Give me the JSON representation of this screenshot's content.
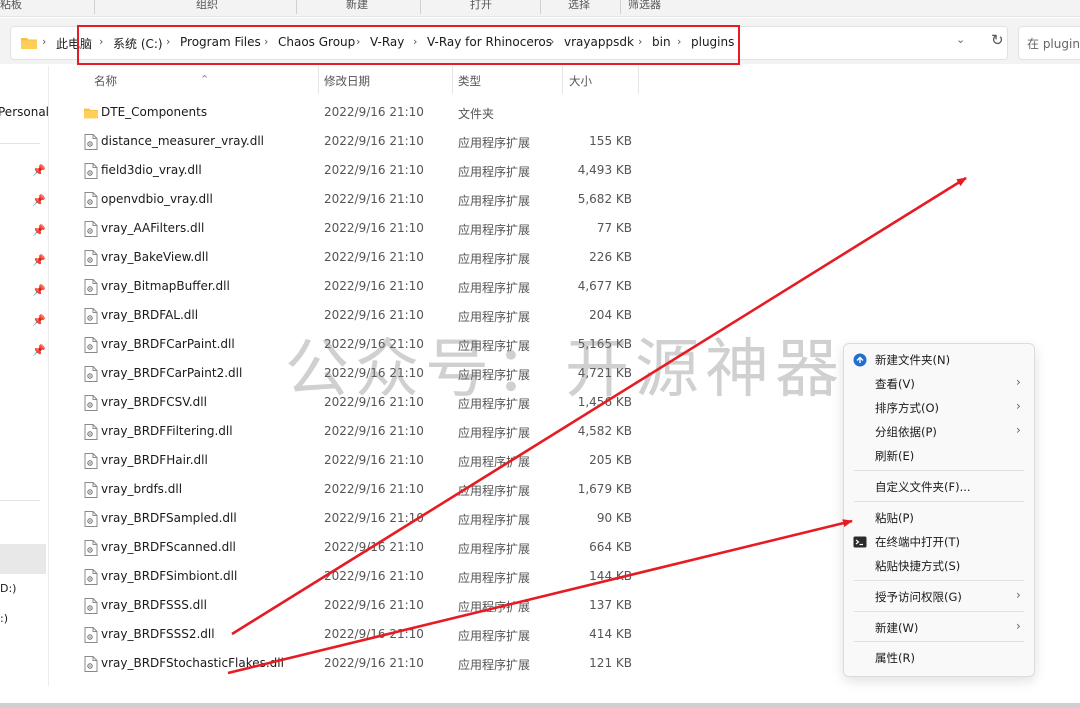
{
  "ribbon": {
    "labels": [
      "粘板",
      "组织",
      "新建",
      "打开",
      "选择",
      "筛选器"
    ]
  },
  "address": {
    "crumbs": [
      "此电脑",
      "系统 (C:)",
      "Program Files",
      "Chaos Group",
      "V-Ray",
      "V-Ray for Rhinoceros",
      "vrayappsdk",
      "bin",
      "plugins"
    ],
    "dropdown_glyph": "⌄",
    "refresh_glyph": "↻",
    "search_placeholder": "在 plugins"
  },
  "nav": {
    "personal_label": "Personal",
    "pin_glyph": "📌",
    "drives": [
      "D:)",
      ":)"
    ]
  },
  "columns": {
    "name": "名称",
    "date": "修改日期",
    "type": "类型",
    "size": "大小"
  },
  "files": [
    {
      "name": "DTE_Components",
      "date": "2022/9/16 21:10",
      "type": "文件夹",
      "size": "",
      "icon": "folder-icon"
    },
    {
      "name": "distance_measurer_vray.dll",
      "date": "2022/9/16 21:10",
      "type": "应用程序扩展",
      "size": "155 KB",
      "icon": "dll-file-icon"
    },
    {
      "name": "field3dio_vray.dll",
      "date": "2022/9/16 21:10",
      "type": "应用程序扩展",
      "size": "4,493 KB",
      "icon": "dll-file-icon"
    },
    {
      "name": "openvdbio_vray.dll",
      "date": "2022/9/16 21:10",
      "type": "应用程序扩展",
      "size": "5,682 KB",
      "icon": "dll-file-icon"
    },
    {
      "name": "vray_AAFilters.dll",
      "date": "2022/9/16 21:10",
      "type": "应用程序扩展",
      "size": "77 KB",
      "icon": "dll-file-icon"
    },
    {
      "name": "vray_BakeView.dll",
      "date": "2022/9/16 21:10",
      "type": "应用程序扩展",
      "size": "226 KB",
      "icon": "dll-file-icon"
    },
    {
      "name": "vray_BitmapBuffer.dll",
      "date": "2022/9/16 21:10",
      "type": "应用程序扩展",
      "size": "4,677 KB",
      "icon": "dll-file-icon"
    },
    {
      "name": "vray_BRDFAL.dll",
      "date": "2022/9/16 21:10",
      "type": "应用程序扩展",
      "size": "204 KB",
      "icon": "dll-file-icon"
    },
    {
      "name": "vray_BRDFCarPaint.dll",
      "date": "2022/9/16 21:10",
      "type": "应用程序扩展",
      "size": "5,165 KB",
      "icon": "dll-file-icon"
    },
    {
      "name": "vray_BRDFCarPaint2.dll",
      "date": "2022/9/16 21:10",
      "type": "应用程序扩展",
      "size": "4,721 KB",
      "icon": "dll-file-icon"
    },
    {
      "name": "vray_BRDFCSV.dll",
      "date": "2022/9/16 21:10",
      "type": "应用程序扩展",
      "size": "1,456 KB",
      "icon": "dll-file-icon"
    },
    {
      "name": "vray_BRDFFiltering.dll",
      "date": "2022/9/16 21:10",
      "type": "应用程序扩展",
      "size": "4,582 KB",
      "icon": "dll-file-icon"
    },
    {
      "name": "vray_BRDFHair.dll",
      "date": "2022/9/16 21:10",
      "type": "应用程序扩展",
      "size": "205 KB",
      "icon": "dll-file-icon"
    },
    {
      "name": "vray_brdfs.dll",
      "date": "2022/9/16 21:10",
      "type": "应用程序扩展",
      "size": "1,679 KB",
      "icon": "dll-file-icon"
    },
    {
      "name": "vray_BRDFSampled.dll",
      "date": "2022/9/16 21:10",
      "type": "应用程序扩展",
      "size": "90 KB",
      "icon": "dll-file-icon"
    },
    {
      "name": "vray_BRDFScanned.dll",
      "date": "2022/9/16 21:10",
      "type": "应用程序扩展",
      "size": "664 KB",
      "icon": "dll-file-icon"
    },
    {
      "name": "vray_BRDFSimbiont.dll",
      "date": "2022/9/16 21:10",
      "type": "应用程序扩展",
      "size": "144 KB",
      "icon": "dll-file-icon"
    },
    {
      "name": "vray_BRDFSSS.dll",
      "date": "2022/9/16 21:10",
      "type": "应用程序扩展",
      "size": "137 KB",
      "icon": "dll-file-icon"
    },
    {
      "name": "vray_BRDFSSS2.dll",
      "date": "2022/9/16 21:10",
      "type": "应用程序扩展",
      "size": "414 KB",
      "icon": "dll-file-icon"
    },
    {
      "name": "vray_BRDFStochasticFlakes.dll",
      "date": "2022/9/16 21:10",
      "type": "应用程序扩展",
      "size": "121 KB",
      "icon": "dll-file-icon"
    }
  ],
  "watermark": "公众号：开源神器",
  "context_menu": {
    "items": [
      {
        "label": "新建文件夹(N)",
        "icon": "new-folder-icon",
        "submenu": false
      },
      {
        "label": "查看(V)",
        "icon": "",
        "submenu": true
      },
      {
        "label": "排序方式(O)",
        "icon": "",
        "submenu": true
      },
      {
        "label": "分组依据(P)",
        "icon": "",
        "submenu": true
      },
      {
        "label": "刷新(E)",
        "icon": "",
        "submenu": false
      },
      {
        "label": "自定义文件夹(F)...",
        "icon": "",
        "submenu": false
      },
      {
        "label": "粘贴(P)",
        "icon": "",
        "submenu": false
      },
      {
        "label": "在终端中打开(T)",
        "icon": "terminal-icon",
        "submenu": false
      },
      {
        "label": "粘贴快捷方式(S)",
        "icon": "",
        "submenu": false
      },
      {
        "label": "授予访问权限(G)",
        "icon": "",
        "submenu": true
      },
      {
        "label": "新建(W)",
        "icon": "",
        "submenu": true
      },
      {
        "label": "属性(R)",
        "icon": "",
        "submenu": false
      }
    ],
    "submenu_glyph": "›"
  },
  "colors": {
    "annotation_red": "#e51c23",
    "folder_yellow": "#f5c242",
    "accent_blue": "#1f6fd1"
  }
}
